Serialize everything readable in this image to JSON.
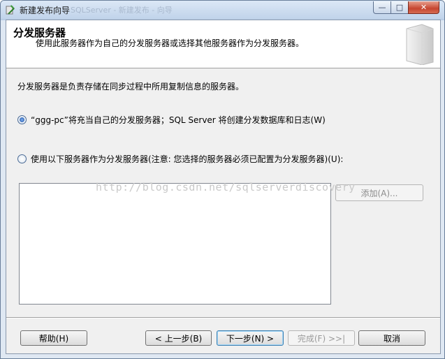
{
  "window": {
    "title": "新建发布向导",
    "title_blurred": "SQLServer - 新建发布 - 向导",
    "buttons": {
      "minimize": "—",
      "maximize": "□",
      "close": "✕"
    }
  },
  "header": {
    "title": "分发服务器",
    "subtitle": "使用此服务器作为自己的分发服务器或选择其他服务器作为分发服务器。"
  },
  "description": "分发服务器是负责存储在同步过程中所用复制信息的服务器。",
  "options": [
    {
      "label": "“ggg-pc”将充当自己的分发服务器；SQL Server 将创建分发数据库和日志(W)",
      "checked": true
    },
    {
      "label": "使用以下服务器作为分发服务器(注意: 您选择的服务器必须已配置为分发服务器)(U):",
      "checked": false
    }
  ],
  "add_button": "添加(A)...",
  "watermark": "http://blog.csdn.net/sqlserverdiscovery",
  "footer": {
    "help": "帮助(H)",
    "back": "< 上一步(B)",
    "next": "下一步(N) >",
    "finish": "完成(F) >>|",
    "cancel": "取消"
  }
}
